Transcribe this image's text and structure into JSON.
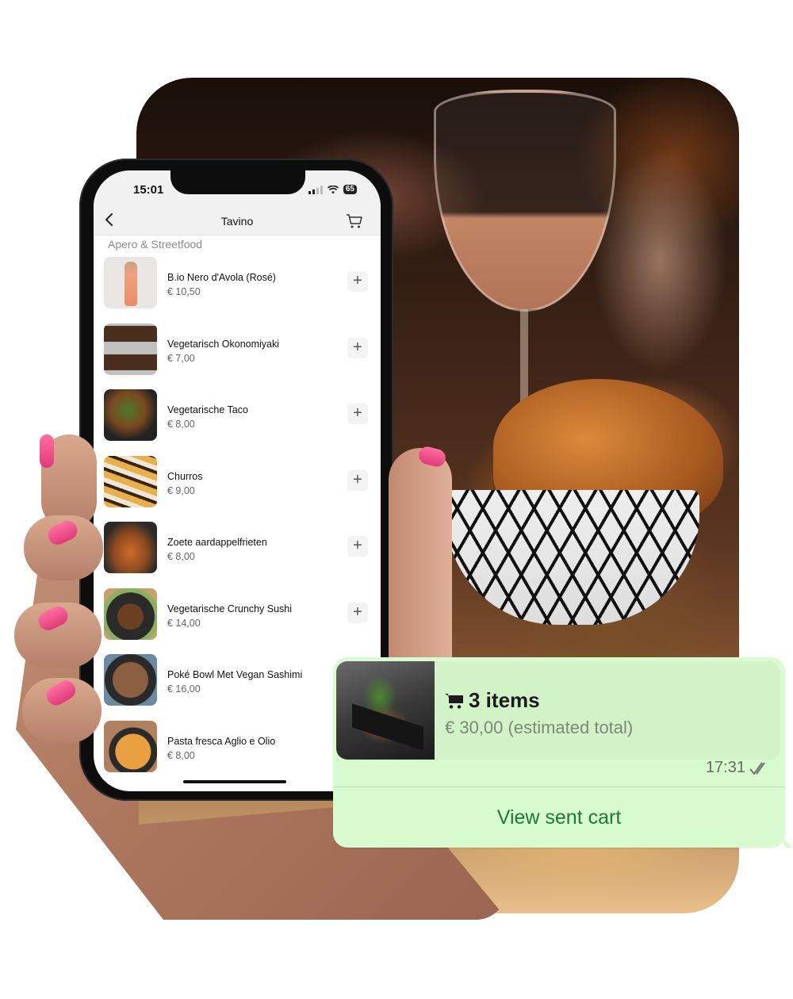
{
  "phone": {
    "status_bar": {
      "time": "15:01",
      "battery": "65",
      "icons": [
        "signal-icon",
        "wifi-icon",
        "battery-icon"
      ]
    },
    "nav": {
      "back_icon": "chevron-left-icon",
      "title": "Tavino",
      "cart_icon": "cart-icon"
    },
    "section_title": "Apero & Streetfood",
    "add_label": "+",
    "menu_items": [
      {
        "name": "B.io Nero d'Avola (Rosé)",
        "price": "€ 10,50"
      },
      {
        "name": "Vegetarisch Okonomiyaki",
        "price": "€ 7,00"
      },
      {
        "name": "Vegetarische Taco",
        "price": "€ 8,00"
      },
      {
        "name": "Churros",
        "price": "€ 9,00"
      },
      {
        "name": "Zoete aardappelfrieten",
        "price": "€ 8,00"
      },
      {
        "name": "Vegetarische Crunchy Sushi",
        "price": "€ 14,00"
      },
      {
        "name": "Poké Bowl Met Vegan Sashimi",
        "price": "€ 16,00"
      },
      {
        "name": "Pasta fresca Aglio e Olio",
        "price": "€ 8,00"
      }
    ]
  },
  "chat_message": {
    "cart_summary": {
      "icon": "cart-icon",
      "items_label": "3 items",
      "total_label": "€ 30,00 (estimated total)"
    },
    "time": "17:31",
    "status_icon": "double-check-icon",
    "action_label": "View sent cart",
    "colors": {
      "bubble": "#d9fbd0",
      "action_text": "#1b7a3e"
    }
  }
}
